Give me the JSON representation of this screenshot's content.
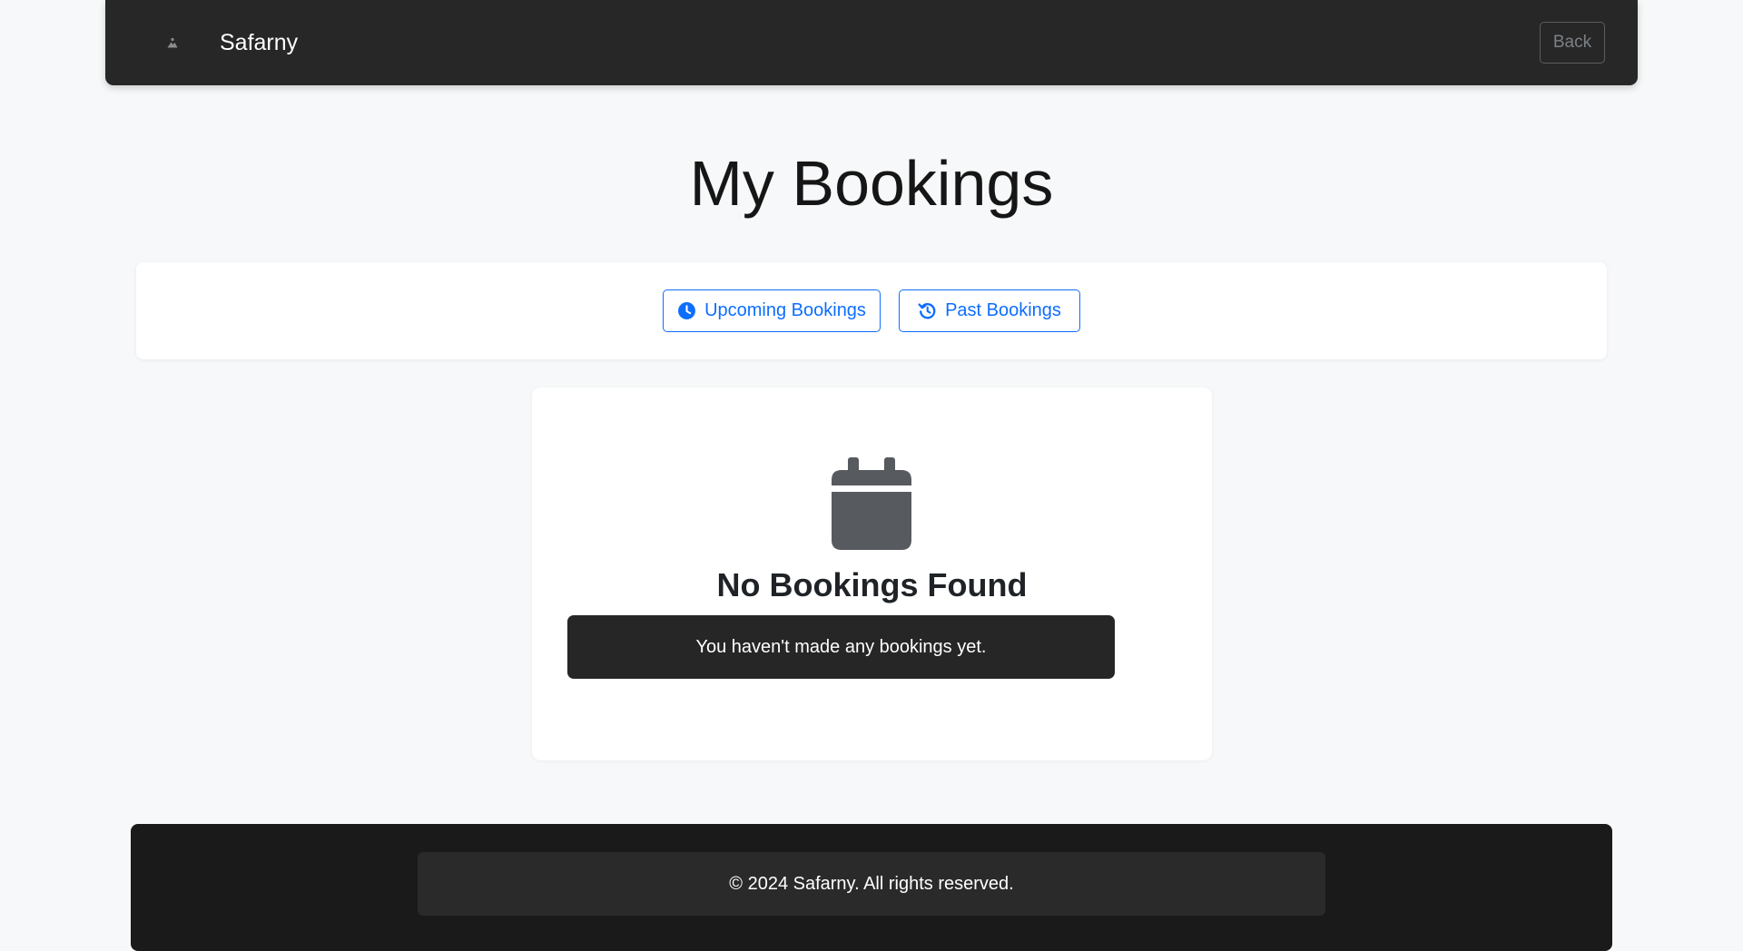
{
  "app": {
    "brand_name": "Safarny",
    "brand_logo_icon": "mountain-logo-icon"
  },
  "navbar": {
    "back_label": "Back"
  },
  "page": {
    "title": "My Bookings"
  },
  "tabs": [
    {
      "label": "Upcoming Bookings",
      "icon": "clock-icon"
    },
    {
      "label": "Past Bookings",
      "icon": "history-icon"
    }
  ],
  "empty_state": {
    "icon": "calendar-icon",
    "title": "No Bookings Found",
    "message": "You haven't made any bookings yet."
  },
  "footer": {
    "copyright": "© 2024 Safarny. All rights reserved."
  },
  "colors": {
    "accent": "#0d6efd",
    "navbar_bg": "#272727",
    "footer_bg": "#1a1a1a",
    "page_bg": "#f7f8f9",
    "icon_gray": "#575a5e"
  }
}
